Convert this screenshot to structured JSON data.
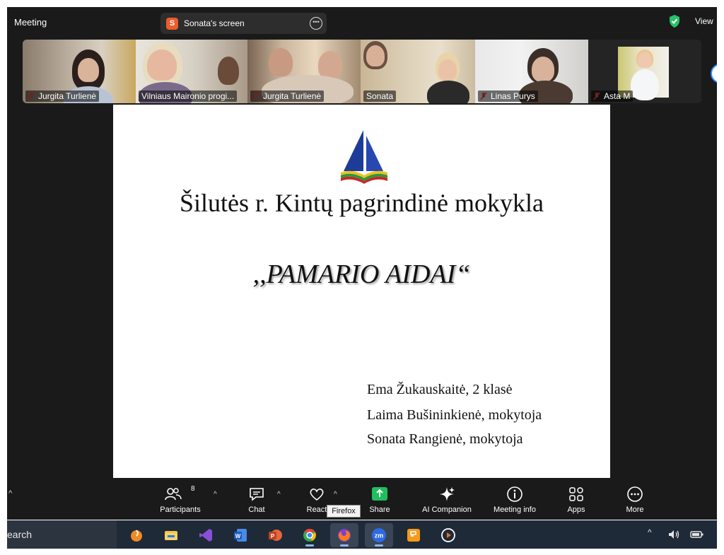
{
  "topbar": {
    "meeting_label": "Meeting",
    "shared_screen_initial": "S",
    "shared_screen_label": "Sonata's screen",
    "view_label": "View",
    "security_color": "#27c26b"
  },
  "participants": [
    {
      "name": "Jurgita Turlienė",
      "muted": true
    },
    {
      "name": "Vilniaus Maironio progi...",
      "muted": false
    },
    {
      "name": "Jurgita Turlienė",
      "muted": true
    },
    {
      "name": "Sonata",
      "muted": false,
      "active_speaker": true
    },
    {
      "name": "Linas Purys",
      "muted": true
    },
    {
      "name": "Asta M",
      "muted": true
    }
  ],
  "slide": {
    "school_title": "Šilutės r. Kintų pagrindinė mokykla",
    "project_title": ",,PAMARIO AIDAI“",
    "credits": [
      "Ema Žukauskaitė, 2 klasė",
      "Laima Bušininkienė, mokytoja",
      "Sonata Rangienė, mokytoja"
    ]
  },
  "toolbar": {
    "participants_label": "Participants",
    "participants_count": "8",
    "chat_label": "Chat",
    "react_label": "React",
    "share_label": "Share",
    "ai_companion_label": "AI Companion",
    "meeting_info_label": "Meeting info",
    "apps_label": "Apps",
    "more_label": "More",
    "share_color": "#1fbf5e"
  },
  "tooltip": {
    "firefox": "Firefox"
  },
  "taskbar": {
    "search_text": "earch",
    "apps": [
      "fl-studio-icon",
      "file-explorer-icon",
      "visual-studio-icon",
      "word-icon",
      "powerpoint-icon",
      "chrome-icon",
      "firefox-icon",
      "zoom-icon",
      "pdf-editor-icon",
      "media-player-icon"
    ],
    "zoom_label": "zm",
    "word_label": "W",
    "ppt_label": "P"
  }
}
